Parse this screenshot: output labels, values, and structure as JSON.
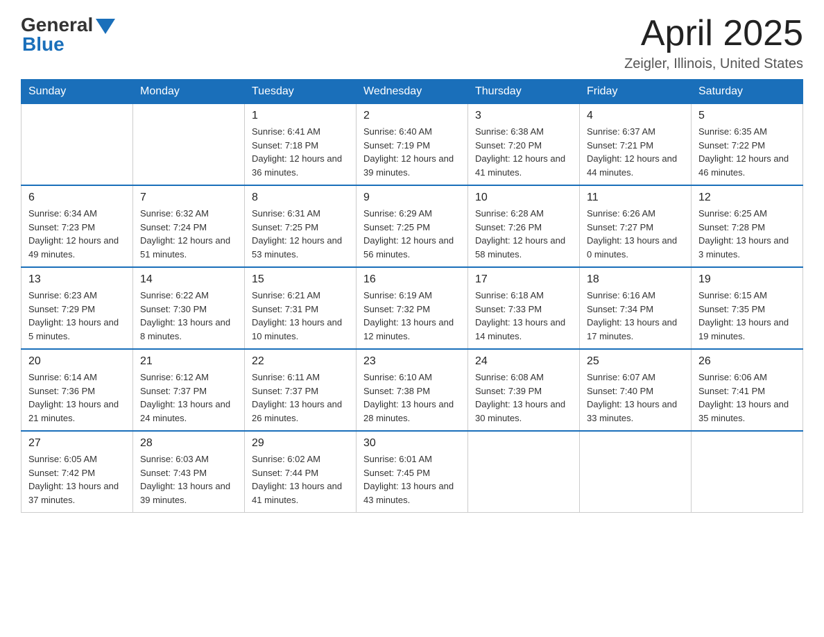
{
  "header": {
    "logo_general": "General",
    "logo_blue": "Blue",
    "title": "April 2025",
    "subtitle": "Zeigler, Illinois, United States"
  },
  "days_of_week": [
    "Sunday",
    "Monday",
    "Tuesday",
    "Wednesday",
    "Thursday",
    "Friday",
    "Saturday"
  ],
  "weeks": [
    [
      {
        "day": "",
        "sunrise": "",
        "sunset": "",
        "daylight": ""
      },
      {
        "day": "",
        "sunrise": "",
        "sunset": "",
        "daylight": ""
      },
      {
        "day": "1",
        "sunrise": "Sunrise: 6:41 AM",
        "sunset": "Sunset: 7:18 PM",
        "daylight": "Daylight: 12 hours and 36 minutes."
      },
      {
        "day": "2",
        "sunrise": "Sunrise: 6:40 AM",
        "sunset": "Sunset: 7:19 PM",
        "daylight": "Daylight: 12 hours and 39 minutes."
      },
      {
        "day": "3",
        "sunrise": "Sunrise: 6:38 AM",
        "sunset": "Sunset: 7:20 PM",
        "daylight": "Daylight: 12 hours and 41 minutes."
      },
      {
        "day": "4",
        "sunrise": "Sunrise: 6:37 AM",
        "sunset": "Sunset: 7:21 PM",
        "daylight": "Daylight: 12 hours and 44 minutes."
      },
      {
        "day": "5",
        "sunrise": "Sunrise: 6:35 AM",
        "sunset": "Sunset: 7:22 PM",
        "daylight": "Daylight: 12 hours and 46 minutes."
      }
    ],
    [
      {
        "day": "6",
        "sunrise": "Sunrise: 6:34 AM",
        "sunset": "Sunset: 7:23 PM",
        "daylight": "Daylight: 12 hours and 49 minutes."
      },
      {
        "day": "7",
        "sunrise": "Sunrise: 6:32 AM",
        "sunset": "Sunset: 7:24 PM",
        "daylight": "Daylight: 12 hours and 51 minutes."
      },
      {
        "day": "8",
        "sunrise": "Sunrise: 6:31 AM",
        "sunset": "Sunset: 7:25 PM",
        "daylight": "Daylight: 12 hours and 53 minutes."
      },
      {
        "day": "9",
        "sunrise": "Sunrise: 6:29 AM",
        "sunset": "Sunset: 7:25 PM",
        "daylight": "Daylight: 12 hours and 56 minutes."
      },
      {
        "day": "10",
        "sunrise": "Sunrise: 6:28 AM",
        "sunset": "Sunset: 7:26 PM",
        "daylight": "Daylight: 12 hours and 58 minutes."
      },
      {
        "day": "11",
        "sunrise": "Sunrise: 6:26 AM",
        "sunset": "Sunset: 7:27 PM",
        "daylight": "Daylight: 13 hours and 0 minutes."
      },
      {
        "day": "12",
        "sunrise": "Sunrise: 6:25 AM",
        "sunset": "Sunset: 7:28 PM",
        "daylight": "Daylight: 13 hours and 3 minutes."
      }
    ],
    [
      {
        "day": "13",
        "sunrise": "Sunrise: 6:23 AM",
        "sunset": "Sunset: 7:29 PM",
        "daylight": "Daylight: 13 hours and 5 minutes."
      },
      {
        "day": "14",
        "sunrise": "Sunrise: 6:22 AM",
        "sunset": "Sunset: 7:30 PM",
        "daylight": "Daylight: 13 hours and 8 minutes."
      },
      {
        "day": "15",
        "sunrise": "Sunrise: 6:21 AM",
        "sunset": "Sunset: 7:31 PM",
        "daylight": "Daylight: 13 hours and 10 minutes."
      },
      {
        "day": "16",
        "sunrise": "Sunrise: 6:19 AM",
        "sunset": "Sunset: 7:32 PM",
        "daylight": "Daylight: 13 hours and 12 minutes."
      },
      {
        "day": "17",
        "sunrise": "Sunrise: 6:18 AM",
        "sunset": "Sunset: 7:33 PM",
        "daylight": "Daylight: 13 hours and 14 minutes."
      },
      {
        "day": "18",
        "sunrise": "Sunrise: 6:16 AM",
        "sunset": "Sunset: 7:34 PM",
        "daylight": "Daylight: 13 hours and 17 minutes."
      },
      {
        "day": "19",
        "sunrise": "Sunrise: 6:15 AM",
        "sunset": "Sunset: 7:35 PM",
        "daylight": "Daylight: 13 hours and 19 minutes."
      }
    ],
    [
      {
        "day": "20",
        "sunrise": "Sunrise: 6:14 AM",
        "sunset": "Sunset: 7:36 PM",
        "daylight": "Daylight: 13 hours and 21 minutes."
      },
      {
        "day": "21",
        "sunrise": "Sunrise: 6:12 AM",
        "sunset": "Sunset: 7:37 PM",
        "daylight": "Daylight: 13 hours and 24 minutes."
      },
      {
        "day": "22",
        "sunrise": "Sunrise: 6:11 AM",
        "sunset": "Sunset: 7:37 PM",
        "daylight": "Daylight: 13 hours and 26 minutes."
      },
      {
        "day": "23",
        "sunrise": "Sunrise: 6:10 AM",
        "sunset": "Sunset: 7:38 PM",
        "daylight": "Daylight: 13 hours and 28 minutes."
      },
      {
        "day": "24",
        "sunrise": "Sunrise: 6:08 AM",
        "sunset": "Sunset: 7:39 PM",
        "daylight": "Daylight: 13 hours and 30 minutes."
      },
      {
        "day": "25",
        "sunrise": "Sunrise: 6:07 AM",
        "sunset": "Sunset: 7:40 PM",
        "daylight": "Daylight: 13 hours and 33 minutes."
      },
      {
        "day": "26",
        "sunrise": "Sunrise: 6:06 AM",
        "sunset": "Sunset: 7:41 PM",
        "daylight": "Daylight: 13 hours and 35 minutes."
      }
    ],
    [
      {
        "day": "27",
        "sunrise": "Sunrise: 6:05 AM",
        "sunset": "Sunset: 7:42 PM",
        "daylight": "Daylight: 13 hours and 37 minutes."
      },
      {
        "day": "28",
        "sunrise": "Sunrise: 6:03 AM",
        "sunset": "Sunset: 7:43 PM",
        "daylight": "Daylight: 13 hours and 39 minutes."
      },
      {
        "day": "29",
        "sunrise": "Sunrise: 6:02 AM",
        "sunset": "Sunset: 7:44 PM",
        "daylight": "Daylight: 13 hours and 41 minutes."
      },
      {
        "day": "30",
        "sunrise": "Sunrise: 6:01 AM",
        "sunset": "Sunset: 7:45 PM",
        "daylight": "Daylight: 13 hours and 43 minutes."
      },
      {
        "day": "",
        "sunrise": "",
        "sunset": "",
        "daylight": ""
      },
      {
        "day": "",
        "sunrise": "",
        "sunset": "",
        "daylight": ""
      },
      {
        "day": "",
        "sunrise": "",
        "sunset": "",
        "daylight": ""
      }
    ]
  ]
}
